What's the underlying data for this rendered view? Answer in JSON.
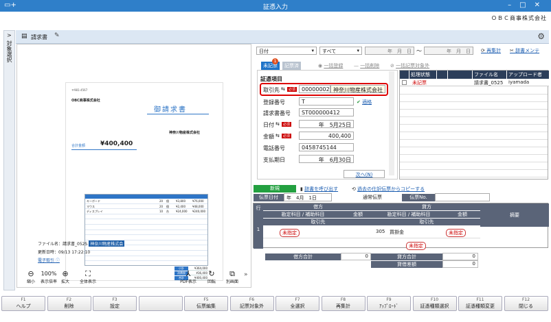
{
  "window": {
    "title": "証憑入力",
    "company": "ＯＢＣ商事株式会社"
  },
  "sidebar": {
    "label": "対象選択",
    "toggle": ">"
  },
  "doctab": {
    "label": "請求書"
  },
  "invoice": {
    "title": "御請求書",
    "amount_label": "合計金額",
    "amount": "¥400,400",
    "client_name": "OBC商事株式会社",
    "issuer": "神奈川物産株式会社",
    "items": [
      {
        "name": "キーボード",
        "qty": "20",
        "unit": "個",
        "price": "¥3,800",
        "total": "¥76,000"
      },
      {
        "name": "マウス",
        "qty": "20",
        "unit": "個",
        "price": "¥2,400",
        "total": "¥48,000"
      },
      {
        "name": "ディスプレイ",
        "qty": "10",
        "unit": "台",
        "price": "¥24,000",
        "total": "¥240,000"
      }
    ],
    "summary": [
      {
        "label": "小計",
        "value": "¥364,000"
      },
      {
        "label": "消費税",
        "value": "¥36,400"
      },
      {
        "label": "合計",
        "value": "¥400,400"
      }
    ]
  },
  "fileinfo": {
    "name_label": "ファイル名：",
    "name_value": "請求書_0525",
    "name_tag": "神奈川物産株式会",
    "updated_label": "更新日時：",
    "updated_value": "09/13 17:22:10",
    "link": "電子取引"
  },
  "preview_toolbar": {
    "zoom_out": "縮小",
    "zoom_level": "100%",
    "zoom_label": "表示倍率",
    "zoom_in": "拡大",
    "fit": "全体表示",
    "pdf": "PDF表示",
    "rotate": "回転",
    "other": "別画面"
  },
  "filter": {
    "field": "日付",
    "mode": "すべて",
    "date_from": "年　月　日",
    "tilde": "〜",
    "date_to": "年　月　日",
    "reaggregate": "再集計",
    "maintenance": "辞書メンテ"
  },
  "status": {
    "unregistered": "未記票",
    "unregistered_count": "1",
    "registered": "記票済",
    "bulk_register": "一括登録",
    "bulk_delete": "一括削除",
    "bulk_exclude": "一括記票対象外"
  },
  "form": {
    "section": "証憑項目",
    "client_label": "取引先",
    "client_code": "00000002",
    "client_name": "神奈川物産株式会社",
    "reg_label": "登録番号",
    "reg_value": "T",
    "reg_link": "適格",
    "invoice_no_label": "請求書番号",
    "invoice_no": "ST000000412",
    "date_label": "日付",
    "date_value": "年　5月25日",
    "amount_label": "金額",
    "amount_value": "400,400",
    "phone_label": "電話番号",
    "phone_value": "0458745144",
    "due_label": "支払期日",
    "due_value": "年　6月30日",
    "required": "必須",
    "next": "次へ(N)"
  },
  "grid": {
    "headers": [
      "",
      "処理状態",
      "",
      "",
      "ファイル名",
      "アップロード者"
    ],
    "rows": [
      {
        "status": "未記票",
        "file": "請求書_0525",
        "user": "iyamada"
      }
    ]
  },
  "journal": {
    "mode": "新規",
    "call_dict": "辞書を呼び出す",
    "copy_past": "過去の仕訳伝票からコピーする",
    "slip_date_label": "伝票日付",
    "slip_date": "年　4月　1日",
    "slip_type": "通常伝票",
    "slip_no_label": "伝票No.",
    "debit": "借方",
    "credit": "貸方",
    "account": "勘定科目 / 補助科目",
    "amount": "金額",
    "partner": "取引先",
    "summary": "摘要",
    "row_label": "行",
    "row_no": "1",
    "unspecified": "未指定",
    "credit_code": "305",
    "credit_account": "買掛金",
    "debit_total_label": "借方合計",
    "debit_total": "0",
    "credit_total_label": "貸方合計",
    "credit_total": "0",
    "diff_label": "貸借差額",
    "diff": "0"
  },
  "fkeys": [
    {
      "key": "F1",
      "label": "ヘルプ"
    },
    {
      "key": "F2",
      "label": "削除"
    },
    {
      "key": "F3",
      "label": "設定"
    },
    {
      "key": "",
      "label": ""
    },
    {
      "key": "F5",
      "label": "伝票編集"
    },
    {
      "key": "F6",
      "label": "記票対象外"
    },
    {
      "key": "F7",
      "label": "全選択"
    },
    {
      "key": "F8",
      "label": "再集計"
    },
    {
      "key": "F9",
      "label": "ｱｯﾌﾟﾛｰﾄﾞ"
    },
    {
      "key": "F10",
      "label": "証憑種類選択"
    },
    {
      "key": "F11",
      "label": "証憑種類変更"
    },
    {
      "key": "F12",
      "label": "閉じる"
    }
  ]
}
